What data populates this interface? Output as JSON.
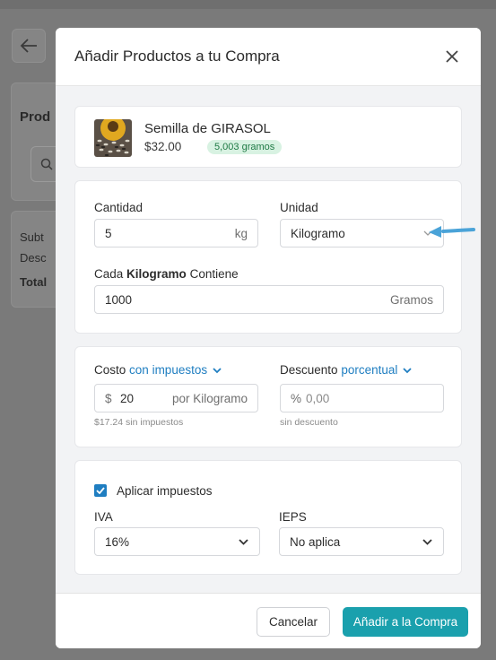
{
  "background": {
    "card1_label": "Prod",
    "summary_lines": [
      "Subt",
      "Desc",
      "Total"
    ]
  },
  "modal": {
    "title": "Añadir Productos a tu Compra"
  },
  "product": {
    "name": "Semilla de GIRASOL",
    "price": "$32.00",
    "stock_badge": "5,003 gramos"
  },
  "quantity": {
    "label": "Cantidad",
    "value": "5",
    "unit_suffix": "kg"
  },
  "unit": {
    "label": "Unidad",
    "selected": "Kilogramo"
  },
  "contains": {
    "label_prefix": "Cada",
    "label_unit": "Kilogramo",
    "label_suffix": "Contiene",
    "value": "1000",
    "suffix": "Gramos"
  },
  "cost": {
    "label": "Costo",
    "mode": "con impuestos",
    "currency": "$",
    "value": "20",
    "per": "por Kilogramo",
    "hint": "$17.24 sin impuestos"
  },
  "discount": {
    "label": "Descuento",
    "mode": "porcentual",
    "symbol": "%",
    "placeholder": "0,00",
    "hint": "sin descuento"
  },
  "taxes": {
    "apply_label": "Aplicar impuestos",
    "apply_checked": true,
    "iva_label": "IVA",
    "iva_value": "16%",
    "ieps_label": "IEPS",
    "ieps_value": "No aplica"
  },
  "footer": {
    "cancel_label": "Cancelar",
    "submit_label": "Añadir a la Compra"
  },
  "colors": {
    "accent": "#1f7ec1",
    "primary_button": "#1aa0ad",
    "badge_bg": "#d8f2e2",
    "badge_text": "#1f7a45"
  },
  "icons": [
    "back-arrow-icon",
    "search-icon",
    "close-icon",
    "chevron-down-icon",
    "check-icon",
    "pointer-arrow-icon"
  ]
}
